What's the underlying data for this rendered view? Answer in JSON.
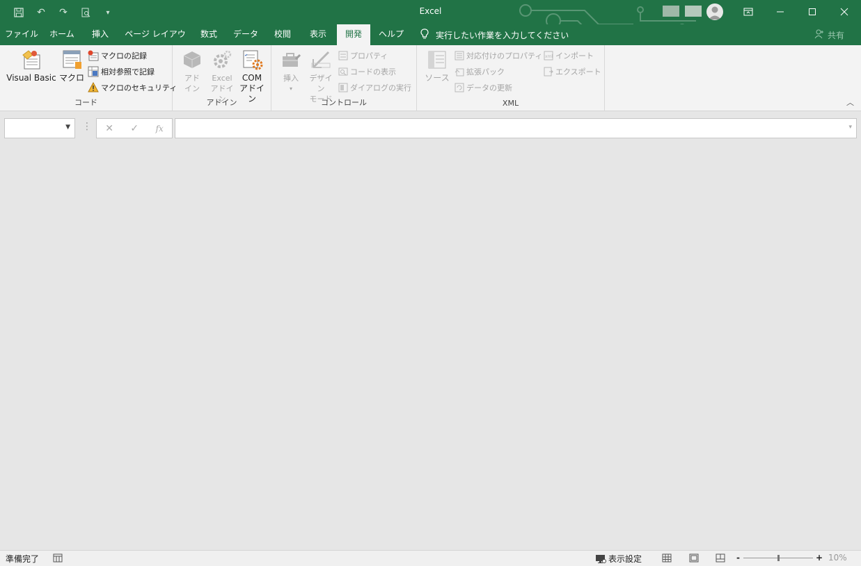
{
  "window": {
    "title": "Excel",
    "controls": [
      "ribbon-display",
      "minimize",
      "maximize",
      "close"
    ]
  },
  "tabs": [
    {
      "label": "ファイル"
    },
    {
      "label": "ホーム"
    },
    {
      "label": "挿入"
    },
    {
      "label": "ページ レイアウト"
    },
    {
      "label": "数式"
    },
    {
      "label": "データ"
    },
    {
      "label": "校閲"
    },
    {
      "label": "表示"
    },
    {
      "label": "開発",
      "active": true
    },
    {
      "label": "ヘルプ"
    }
  ],
  "tell_me": "実行したい作業を入力してください",
  "share": "共有",
  "ribbon": {
    "code": {
      "label": "コード",
      "visual_basic": "Visual Basic",
      "macro": "マクロ",
      "record_macro": "マクロの記録",
      "relative_ref": "相対参照で記録",
      "macro_security": "マクロのセキュリティ"
    },
    "addins": {
      "label": "アドイン",
      "addin_line1": "アド",
      "addin_line2": "イン",
      "excel_addin_line1": "Excel",
      "excel_addin_line2": "アドイン",
      "com_addin_line1": "COM",
      "com_addin_line2": "アドイン"
    },
    "controls": {
      "label": "コントロール",
      "insert": "挿入",
      "design_line1": "デザイン",
      "design_line2": "モード",
      "properties": "プロパティ",
      "view_code": "コードの表示",
      "run_dialog": "ダイアログの実行"
    },
    "xml": {
      "label": "XML",
      "source": "ソース",
      "map_properties": "対応付けのプロパティ",
      "expansion_packs": "拡張パック",
      "refresh_data": "データの更新",
      "import": "インポート",
      "export": "エクスポート"
    }
  },
  "formula_bar": {
    "name_box": "",
    "formula": "",
    "fx_label": "fx"
  },
  "status": {
    "ready": "準備完了",
    "display_settings": "表示設定",
    "zoom": "10%",
    "zoom_out": "-",
    "zoom_in": "+"
  },
  "colors": {
    "brand": "#217346",
    "ribbon_bg": "#f3f3f3",
    "workspace": "#e6e6e6"
  }
}
